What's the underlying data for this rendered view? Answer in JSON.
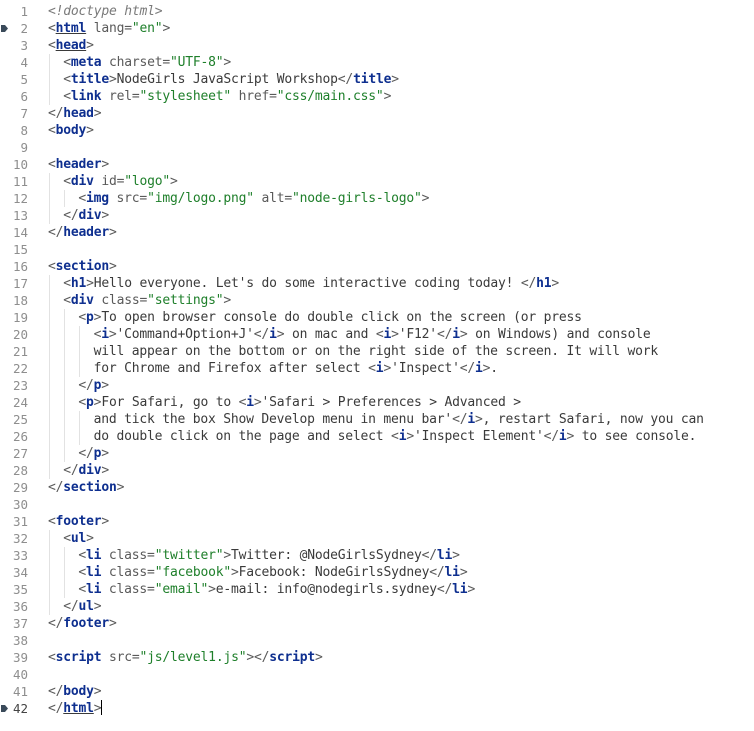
{
  "editor": {
    "active_line": 42,
    "bookmarked_lines": [
      2,
      42
    ],
    "colors": {
      "tag": "#0E2F8F",
      "string": "#1E7F2A",
      "punctuation": "#5A5A5A",
      "text": "#3A3A3A",
      "doctype": "#7A7A7A",
      "line_number": "#8E8E8E"
    },
    "lines": [
      {
        "n": "1",
        "indent": 0,
        "tokens": [
          [
            "doc",
            "<!doctype html>"
          ]
        ]
      },
      {
        "n": "2",
        "indent": 0,
        "tokens": [
          [
            "punct",
            "<"
          ],
          [
            "tag",
            "html"
          ],
          [
            "attr",
            " lang="
          ],
          [
            "str",
            "\"en\""
          ],
          [
            "punct",
            ">"
          ]
        ]
      },
      {
        "n": "3",
        "indent": 0,
        "tokens": [
          [
            "punct",
            "<"
          ],
          [
            "tag",
            "head"
          ],
          [
            "punct",
            ">"
          ]
        ]
      },
      {
        "n": "4",
        "indent": 2,
        "tokens": [
          [
            "punct",
            "<"
          ],
          [
            "tag",
            "meta"
          ],
          [
            "attr",
            " charset="
          ],
          [
            "str",
            "\"UTF-8\""
          ],
          [
            "punct",
            ">"
          ]
        ]
      },
      {
        "n": "5",
        "indent": 2,
        "tokens": [
          [
            "punct",
            "<"
          ],
          [
            "tag",
            "title"
          ],
          [
            "punct",
            ">"
          ],
          [
            "text",
            "NodeGirls JavaScript Workshop"
          ],
          [
            "punct",
            "</"
          ],
          [
            "tag",
            "title"
          ],
          [
            "punct",
            ">"
          ]
        ]
      },
      {
        "n": "6",
        "indent": 2,
        "tokens": [
          [
            "punct",
            "<"
          ],
          [
            "tag",
            "link"
          ],
          [
            "attr",
            " rel="
          ],
          [
            "str",
            "\"stylesheet\""
          ],
          [
            "attr",
            " href="
          ],
          [
            "str",
            "\"css/main.css\""
          ],
          [
            "punct",
            ">"
          ]
        ]
      },
      {
        "n": "7",
        "indent": 0,
        "tokens": [
          [
            "punct",
            "</"
          ],
          [
            "tag",
            "head"
          ],
          [
            "punct",
            ">"
          ]
        ]
      },
      {
        "n": "8",
        "indent": 0,
        "tokens": [
          [
            "punct",
            "<"
          ],
          [
            "tag",
            "body"
          ],
          [
            "punct",
            ">"
          ]
        ]
      },
      {
        "n": "9",
        "indent": 0,
        "tokens": []
      },
      {
        "n": "10",
        "indent": 0,
        "tokens": [
          [
            "punct",
            "<"
          ],
          [
            "tag",
            "header"
          ],
          [
            "punct",
            ">"
          ]
        ]
      },
      {
        "n": "11",
        "indent": 2,
        "tokens": [
          [
            "punct",
            "<"
          ],
          [
            "tag",
            "div"
          ],
          [
            "attr",
            " id="
          ],
          [
            "str",
            "\"logo\""
          ],
          [
            "punct",
            ">"
          ]
        ]
      },
      {
        "n": "12",
        "indent": 4,
        "tokens": [
          [
            "punct",
            "<"
          ],
          [
            "tag",
            "img"
          ],
          [
            "attr",
            " src="
          ],
          [
            "str",
            "\"img/logo.png\""
          ],
          [
            "attr",
            " alt="
          ],
          [
            "str",
            "\"node-girls-logo\""
          ],
          [
            "punct",
            ">"
          ]
        ]
      },
      {
        "n": "13",
        "indent": 2,
        "tokens": [
          [
            "punct",
            "</"
          ],
          [
            "tag",
            "div"
          ],
          [
            "punct",
            ">"
          ]
        ]
      },
      {
        "n": "14",
        "indent": 0,
        "tokens": [
          [
            "punct",
            "</"
          ],
          [
            "tag",
            "header"
          ],
          [
            "punct",
            ">"
          ]
        ]
      },
      {
        "n": "15",
        "indent": 0,
        "tokens": []
      },
      {
        "n": "16",
        "indent": 0,
        "tokens": [
          [
            "punct",
            "<"
          ],
          [
            "tag",
            "section"
          ],
          [
            "punct",
            ">"
          ]
        ]
      },
      {
        "n": "17",
        "indent": 2,
        "tokens": [
          [
            "punct",
            "<"
          ],
          [
            "tag",
            "h1"
          ],
          [
            "punct",
            ">"
          ],
          [
            "text",
            "Hello everyone. Let's do some interactive coding today! "
          ],
          [
            "punct",
            "</"
          ],
          [
            "tag",
            "h1"
          ],
          [
            "punct",
            ">"
          ]
        ]
      },
      {
        "n": "18",
        "indent": 2,
        "tokens": [
          [
            "punct",
            "<"
          ],
          [
            "tag",
            "div"
          ],
          [
            "attr",
            " class="
          ],
          [
            "str",
            "\"settings\""
          ],
          [
            "punct",
            ">"
          ]
        ]
      },
      {
        "n": "19",
        "indent": 4,
        "tokens": [
          [
            "punct",
            "<"
          ],
          [
            "tag",
            "p"
          ],
          [
            "punct",
            ">"
          ],
          [
            "text",
            "To open browser console do double click on the screen (or press"
          ]
        ]
      },
      {
        "n": "20",
        "indent": 6,
        "tokens": [
          [
            "punct",
            "<"
          ],
          [
            "tag",
            "i"
          ],
          [
            "punct",
            ">"
          ],
          [
            "text",
            "'Command+Option+J'"
          ],
          [
            "punct",
            "</"
          ],
          [
            "tag",
            "i"
          ],
          [
            "punct",
            ">"
          ],
          [
            "text",
            " on mac and "
          ],
          [
            "punct",
            "<"
          ],
          [
            "tag",
            "i"
          ],
          [
            "punct",
            ">"
          ],
          [
            "text",
            "'F12'"
          ],
          [
            "punct",
            "</"
          ],
          [
            "tag",
            "i"
          ],
          [
            "punct",
            ">"
          ],
          [
            "text",
            " on Windows) and console"
          ]
        ]
      },
      {
        "n": "21",
        "indent": 6,
        "tokens": [
          [
            "text",
            "will appear on the bottom or on the right side of the screen. It will work"
          ]
        ]
      },
      {
        "n": "22",
        "indent": 6,
        "tokens": [
          [
            "text",
            "for Chrome and Firefox after select "
          ],
          [
            "punct",
            "<"
          ],
          [
            "tag",
            "i"
          ],
          [
            "punct",
            ">"
          ],
          [
            "text",
            "'Inspect'"
          ],
          [
            "punct",
            "</"
          ],
          [
            "tag",
            "i"
          ],
          [
            "punct",
            ">"
          ],
          [
            "text",
            "."
          ]
        ]
      },
      {
        "n": "23",
        "indent": 4,
        "tokens": [
          [
            "punct",
            "</"
          ],
          [
            "tag",
            "p"
          ],
          [
            "punct",
            ">"
          ]
        ]
      },
      {
        "n": "24",
        "indent": 4,
        "tokens": [
          [
            "punct",
            "<"
          ],
          [
            "tag",
            "p"
          ],
          [
            "punct",
            ">"
          ],
          [
            "text",
            "For Safari, go to "
          ],
          [
            "punct",
            "<"
          ],
          [
            "tag",
            "i"
          ],
          [
            "punct",
            ">"
          ],
          [
            "text",
            "'Safari > Preferences > Advanced >"
          ]
        ]
      },
      {
        "n": "25",
        "indent": 6,
        "tokens": [
          [
            "text",
            "and tick the box Show Develop menu in menu bar'"
          ],
          [
            "punct",
            "</"
          ],
          [
            "tag",
            "i"
          ],
          [
            "punct",
            ">"
          ],
          [
            "text",
            ", restart Safari, now you can"
          ]
        ]
      },
      {
        "n": "26",
        "indent": 6,
        "tokens": [
          [
            "text",
            "do double click on the page and select "
          ],
          [
            "punct",
            "<"
          ],
          [
            "tag",
            "i"
          ],
          [
            "punct",
            ">"
          ],
          [
            "text",
            "'Inspect Element'"
          ],
          [
            "punct",
            "</"
          ],
          [
            "tag",
            "i"
          ],
          [
            "punct",
            ">"
          ],
          [
            "text",
            " to see console."
          ]
        ]
      },
      {
        "n": "27",
        "indent": 4,
        "tokens": [
          [
            "punct",
            "</"
          ],
          [
            "tag",
            "p"
          ],
          [
            "punct",
            ">"
          ]
        ]
      },
      {
        "n": "28",
        "indent": 2,
        "tokens": [
          [
            "punct",
            "</"
          ],
          [
            "tag",
            "div"
          ],
          [
            "punct",
            ">"
          ]
        ]
      },
      {
        "n": "29",
        "indent": 0,
        "tokens": [
          [
            "punct",
            "</"
          ],
          [
            "tag",
            "section"
          ],
          [
            "punct",
            ">"
          ]
        ]
      },
      {
        "n": "30",
        "indent": 0,
        "tokens": []
      },
      {
        "n": "31",
        "indent": 0,
        "tokens": [
          [
            "punct",
            "<"
          ],
          [
            "tag",
            "footer"
          ],
          [
            "punct",
            ">"
          ]
        ]
      },
      {
        "n": "32",
        "indent": 2,
        "tokens": [
          [
            "punct",
            "<"
          ],
          [
            "tag",
            "ul"
          ],
          [
            "punct",
            ">"
          ]
        ]
      },
      {
        "n": "33",
        "indent": 4,
        "tokens": [
          [
            "punct",
            "<"
          ],
          [
            "tag",
            "li"
          ],
          [
            "attr",
            " class="
          ],
          [
            "str",
            "\"twitter\""
          ],
          [
            "punct",
            ">"
          ],
          [
            "text",
            "Twitter: @NodeGirlsSydney"
          ],
          [
            "punct",
            "</"
          ],
          [
            "tag",
            "li"
          ],
          [
            "punct",
            ">"
          ]
        ]
      },
      {
        "n": "34",
        "indent": 4,
        "tokens": [
          [
            "punct",
            "<"
          ],
          [
            "tag",
            "li"
          ],
          [
            "attr",
            " class="
          ],
          [
            "str",
            "\"facebook\""
          ],
          [
            "punct",
            ">"
          ],
          [
            "text",
            "Facebook: NodeGirlsSydney"
          ],
          [
            "punct",
            "</"
          ],
          [
            "tag",
            "li"
          ],
          [
            "punct",
            ">"
          ]
        ]
      },
      {
        "n": "35",
        "indent": 4,
        "tokens": [
          [
            "punct",
            "<"
          ],
          [
            "tag",
            "li"
          ],
          [
            "attr",
            " class="
          ],
          [
            "str",
            "\"email\""
          ],
          [
            "punct",
            ">"
          ],
          [
            "text",
            "e-mail: info@nodegirls.sydney"
          ],
          [
            "punct",
            "</"
          ],
          [
            "tag",
            "li"
          ],
          [
            "punct",
            ">"
          ]
        ]
      },
      {
        "n": "36",
        "indent": 2,
        "tokens": [
          [
            "punct",
            "</"
          ],
          [
            "tag",
            "ul"
          ],
          [
            "punct",
            ">"
          ]
        ]
      },
      {
        "n": "37",
        "indent": 0,
        "tokens": [
          [
            "punct",
            "</"
          ],
          [
            "tag",
            "footer"
          ],
          [
            "punct",
            ">"
          ]
        ]
      },
      {
        "n": "38",
        "indent": 0,
        "tokens": []
      },
      {
        "n": "39",
        "indent": 0,
        "tokens": [
          [
            "punct",
            "<"
          ],
          [
            "tag",
            "script"
          ],
          [
            "attr",
            " src="
          ],
          [
            "str",
            "\"js/level1.js\""
          ],
          [
            "punct",
            "></"
          ],
          [
            "tag",
            "script"
          ],
          [
            "punct",
            ">"
          ]
        ]
      },
      {
        "n": "40",
        "indent": 0,
        "tokens": []
      },
      {
        "n": "41",
        "indent": 0,
        "tokens": [
          [
            "punct",
            "</"
          ],
          [
            "tag",
            "body"
          ],
          [
            "punct",
            ">"
          ]
        ]
      },
      {
        "n": "42",
        "indent": 0,
        "tokens": [
          [
            "punct",
            "</"
          ],
          [
            "tag",
            "html"
          ],
          [
            "punct",
            ">"
          ]
        ]
      }
    ]
  }
}
